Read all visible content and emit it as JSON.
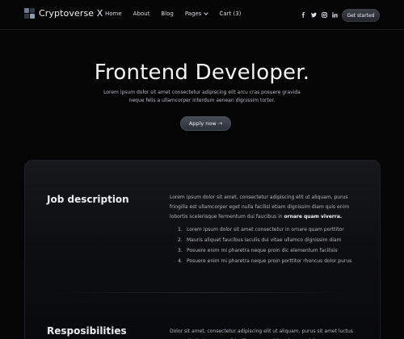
{
  "brand": {
    "name": "Cryptoverse X",
    "icon": "cube-logo-icon"
  },
  "nav": {
    "items": [
      "Home",
      "About",
      "Blog",
      "Pages",
      "Cart (3)"
    ],
    "socials": [
      "facebook-icon",
      "twitter-icon",
      "instagram-icon",
      "linkedin-icon"
    ],
    "cta_label": "Get started"
  },
  "hero": {
    "title": "Frontend Developer.",
    "subtitle": "Lorem ipsum dolor sit amet consectetur adipiscing elit arcu cras posuere gravida neque felis a ullamcorper interdum aenean dignissim tortor.",
    "apply_label": "Apply now →"
  },
  "job": {
    "title": "Job description",
    "text": "Lorem ipsum dolor sit amet, consectetur adipiscing elit ut aliquam, purus fringilla est ullamcorper eget nulla facilisi etiam dignissim diam quis enim lobortis scelerisque fermentum dui faucibus in",
    "text_bold": "ornare quam viverra.",
    "list": [
      {
        "num": "1.",
        "text": "Lorem ipsum dolor sit amet consectetur in ornare quam porttitor"
      },
      {
        "num": "2.",
        "text": "Mauris aliquet faucibus iaculis dui vitae ullamco dignissim diam"
      },
      {
        "num": "3.",
        "text": "Posuere enim mi pharetra neque proin dic elementum facilisis"
      },
      {
        "num": "4.",
        "text": "Posuere enim mi pharetra neque proin porttitor rhoncus dolor purus"
      }
    ]
  },
  "responsibilities": {
    "title": "Resposibilities",
    "text": "Dolor sit amet, consectetur adipiscing elit ut aliquam, purus sit amet luctus venenatis, lectus magna fringilla urna, porttitor rhoncus dolor purus"
  },
  "colors": {
    "background": "#050506",
    "accent": "#3a3f48"
  }
}
